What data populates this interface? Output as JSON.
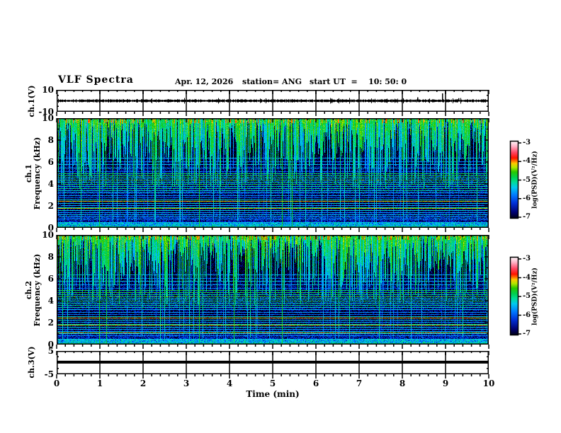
{
  "figure": {
    "title": "VLF Spectra",
    "date": "Apr. 12, 2026",
    "station": "station= ANG",
    "start_ut": "start UT  =    10: 50: 0"
  },
  "xaxis": {
    "label": "Time (min)",
    "min": 0,
    "max": 10,
    "tick_labels": [
      "0",
      "1",
      "2",
      "3",
      "4",
      "5",
      "6",
      "7",
      "8",
      "9",
      "10"
    ],
    "minor_step_min": 0.2
  },
  "panels": {
    "ch1_wave": {
      "ylabel": "ch.1(V)",
      "ymin": -10,
      "ymax": 10,
      "yticks": [
        {
          "v": 10,
          "label": "10"
        },
        {
          "v": -10,
          "label": "-10"
        }
      ]
    },
    "spec1": {
      "ylabel_ch": "ch.1",
      "ylabel_freq": "Frequency (kHz)",
      "ymin": 0,
      "ymax": 10,
      "yticks": [
        {
          "v": 0,
          "label": "0"
        },
        {
          "v": 2,
          "label": "2"
        },
        {
          "v": 4,
          "label": "4"
        },
        {
          "v": 6,
          "label": "6"
        },
        {
          "v": 8,
          "label": "8"
        },
        {
          "v": 10,
          "label": "10"
        }
      ]
    },
    "spec2": {
      "ylabel_ch": "ch.2",
      "ylabel_freq": "Frequency (kHz)",
      "ymin": 0,
      "ymax": 10,
      "yticks": [
        {
          "v": 0,
          "label": "0"
        },
        {
          "v": 2,
          "label": "2"
        },
        {
          "v": 4,
          "label": "4"
        },
        {
          "v": 6,
          "label": "6"
        },
        {
          "v": 8,
          "label": "8"
        },
        {
          "v": 10,
          "label": "10"
        }
      ]
    },
    "ch3": {
      "ylabel": "ch.3(V)",
      "ymin": -5,
      "ymax": 5,
      "yticks": [
        {
          "v": 5,
          "label": "5"
        },
        {
          "v": -5,
          "label": "-5"
        }
      ]
    }
  },
  "colorbar": {
    "label": "log(PSD)(V²/Hz)",
    "min": -7,
    "max": -3,
    "tick_labels": [
      "-3",
      "-4",
      "-5",
      "-6",
      "-7"
    ],
    "gradient": [
      [
        0.0,
        "#000010"
      ],
      [
        0.08,
        "#000070"
      ],
      [
        0.2,
        "#0030d8"
      ],
      [
        0.3,
        "#0078ff"
      ],
      [
        0.4,
        "#00c8f0"
      ],
      [
        0.47,
        "#00dc96"
      ],
      [
        0.53,
        "#00d050"
      ],
      [
        0.6,
        "#28c800"
      ],
      [
        0.66,
        "#b4e600"
      ],
      [
        0.71,
        "#ffc800"
      ],
      [
        0.745,
        "#ff6400"
      ],
      [
        0.78,
        "#ff1400"
      ],
      [
        0.85,
        "#ff4664"
      ],
      [
        0.93,
        "#ffb4c8"
      ],
      [
        1.0,
        "#ffffff"
      ]
    ]
  },
  "chart_data": [
    {
      "type": "line",
      "name": "ch1-waveform",
      "ylabel": "ch.1(V)",
      "xlabel": "Time (min)",
      "xlim": [
        0,
        10
      ],
      "ylim": [
        -10,
        10
      ],
      "series": [
        {
          "name": "ch.1 voltage",
          "description": "continuous broadband noise centered on 0 V",
          "noise_amplitude_volts": 1.3,
          "spikes": [
            {
              "t_min": 8.35,
              "volts": 3.2
            },
            {
              "t_min": 8.92,
              "volts": 6.8
            },
            {
              "t_min": 9.3,
              "volts": 2.4
            }
          ]
        }
      ],
      "seed": 13
    },
    {
      "type": "heatmap",
      "name": "ch1-spectrogram",
      "ylabel": "ch.1 Frequency (kHz)",
      "xlabel": "Time (min)",
      "xlim": [
        0,
        10
      ],
      "ylim": [
        0,
        10
      ],
      "zlabel": "log(PSD)(V²/Hz)",
      "zlim": [
        -7,
        -3
      ],
      "background_profile": [
        [
          0,
          -5.6
        ],
        [
          0.35,
          -5.75
        ],
        [
          0.55,
          -6.45
        ],
        [
          1.0,
          -6.55
        ],
        [
          1.5,
          -6.8
        ],
        [
          2.2,
          -6.9
        ],
        [
          2.7,
          -7.0
        ],
        [
          3.2,
          -6.6
        ],
        [
          4.1,
          -6.55
        ],
        [
          5.0,
          -6.7
        ],
        [
          5.9,
          -6.85
        ],
        [
          6.6,
          -7.0
        ],
        [
          8.3,
          -7.0
        ],
        [
          8.9,
          -6.75
        ],
        [
          9.6,
          -6.4
        ],
        [
          10,
          -6.2
        ]
      ],
      "noise_sigma": 0.55,
      "horizontal_lines": [
        [
          6.35,
          -5.6
        ],
        [
          6.05,
          -5.8
        ],
        [
          5.75,
          -5.5
        ],
        [
          5.45,
          -5.65
        ],
        [
          5.15,
          -5.9
        ],
        [
          4.95,
          -4.9
        ],
        [
          4.75,
          -4.8
        ],
        [
          4.55,
          -4.95
        ],
        [
          4.35,
          -4.7
        ],
        [
          4.15,
          -5.0
        ],
        [
          3.95,
          -4.85
        ],
        [
          3.75,
          -5.1
        ],
        [
          3.55,
          -5.0
        ],
        [
          3.35,
          -5.2
        ],
        [
          3.15,
          -5.5
        ],
        [
          2.95,
          -5.65
        ],
        [
          2.75,
          -5.9
        ],
        [
          2.55,
          -5.35
        ],
        [
          2.43,
          -4.25
        ],
        [
          2.2,
          -5.4
        ],
        [
          2.0,
          -5.6
        ],
        [
          1.85,
          -5.25
        ],
        [
          1.73,
          -4.3
        ],
        [
          1.55,
          -5.35
        ],
        [
          1.35,
          -5.6
        ],
        [
          1.15,
          -5.45
        ],
        [
          0.95,
          -5.55
        ],
        [
          0.75,
          -5.7
        ],
        [
          0.45,
          -5.4
        ]
      ],
      "vertical_lines_min": [
        0.98,
        3.3,
        5.22,
        5.45
      ],
      "impulse_density": 0.85,
      "seed": 1234
    },
    {
      "type": "heatmap",
      "name": "ch2-spectrogram",
      "ylabel": "ch.2 Frequency (kHz)",
      "xlabel": "Time (min)",
      "xlim": [
        0,
        10
      ],
      "ylim": [
        0,
        10
      ],
      "zlabel": "log(PSD)(V²/Hz)",
      "zlim": [
        -7,
        -3
      ],
      "background_profile": [
        [
          0,
          -5.6
        ],
        [
          0.35,
          -5.75
        ],
        [
          0.55,
          -6.45
        ],
        [
          1.0,
          -6.55
        ],
        [
          1.5,
          -6.8
        ],
        [
          2.2,
          -6.9
        ],
        [
          2.7,
          -7.0
        ],
        [
          3.2,
          -6.6
        ],
        [
          4.1,
          -6.55
        ],
        [
          5.0,
          -6.7
        ],
        [
          5.9,
          -6.85
        ],
        [
          6.6,
          -7.0
        ],
        [
          8.3,
          -7.0
        ],
        [
          8.9,
          -6.75
        ],
        [
          9.6,
          -6.4
        ],
        [
          10,
          -6.2
        ]
      ],
      "noise_sigma": 0.55,
      "horizontal_lines": [
        [
          6.35,
          -5.6
        ],
        [
          6.05,
          -5.8
        ],
        [
          5.75,
          -5.5
        ],
        [
          5.45,
          -5.65
        ],
        [
          5.15,
          -5.9
        ],
        [
          4.95,
          -4.9
        ],
        [
          4.75,
          -4.8
        ],
        [
          4.55,
          -4.95
        ],
        [
          4.35,
          -4.7
        ],
        [
          4.15,
          -5.0
        ],
        [
          3.95,
          -4.85
        ],
        [
          3.75,
          -5.1
        ],
        [
          3.55,
          -5.0
        ],
        [
          3.35,
          -5.2
        ],
        [
          3.15,
          -5.5
        ],
        [
          2.95,
          -5.65
        ],
        [
          2.75,
          -5.9
        ],
        [
          2.55,
          -5.35
        ],
        [
          2.43,
          -4.2
        ],
        [
          2.2,
          -5.4
        ],
        [
          2.0,
          -5.6
        ],
        [
          1.85,
          -5.25
        ],
        [
          1.73,
          -4.3
        ],
        [
          1.55,
          -5.35
        ],
        [
          1.35,
          -5.6
        ],
        [
          1.15,
          -5.45
        ],
        [
          1.05,
          -4.35
        ],
        [
          0.95,
          -5.55
        ],
        [
          0.75,
          -5.7
        ],
        [
          0.45,
          -5.4
        ]
      ],
      "vertical_lines_min": [
        0.98,
        1.15,
        3.3,
        4.1,
        5.22
      ],
      "impulse_density": 0.85,
      "seed": 5678
    },
    {
      "type": "line",
      "name": "ch3-trace",
      "ylabel": "ch.3(V)",
      "xlabel": "Time (min)",
      "xlim": [
        0,
        10
      ],
      "ylim": [
        -5,
        5
      ],
      "series": [
        {
          "name": "ch.3 voltage",
          "description": "flat saturated trace",
          "value_volts": 0.2,
          "line_thickness_volts": 1.2
        }
      ]
    }
  ]
}
